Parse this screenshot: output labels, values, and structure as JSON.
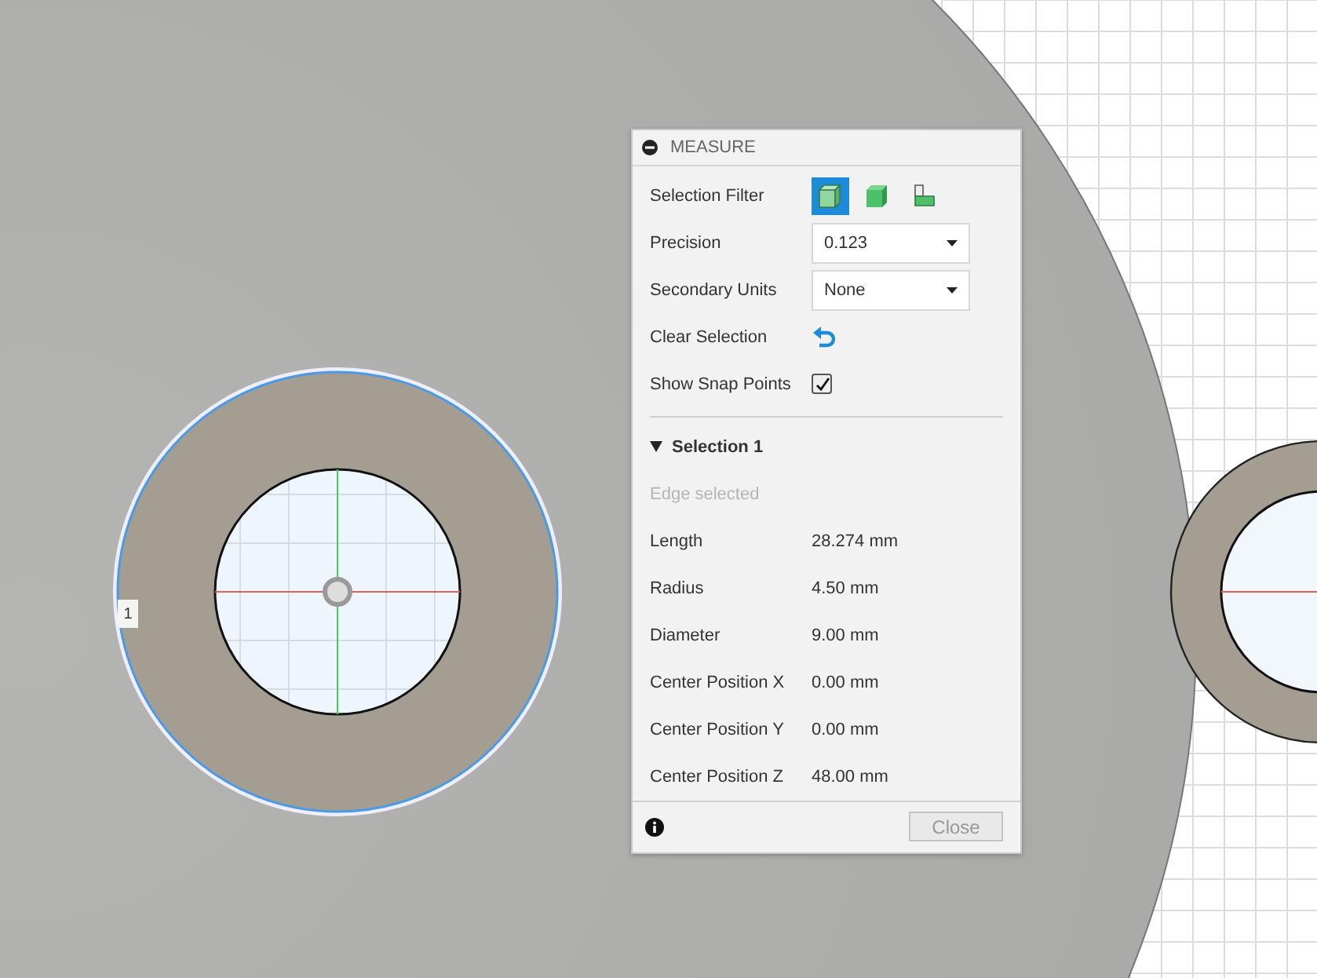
{
  "viewport": {
    "marker_label": "1"
  },
  "panel": {
    "title": "MEASURE",
    "selection_filter": {
      "label": "Selection Filter",
      "options": [
        {
          "kind": "face",
          "selected": true
        },
        {
          "kind": "body",
          "selected": false
        },
        {
          "kind": "edge",
          "selected": false
        }
      ]
    },
    "precision": {
      "label": "Precision",
      "value": "0.123"
    },
    "secondary_units": {
      "label": "Secondary Units",
      "value": "None"
    },
    "clear_selection": {
      "label": "Clear Selection"
    },
    "show_snap_points": {
      "label": "Show Snap Points",
      "checked": true
    },
    "section": {
      "title": "Selection 1",
      "expanded": true,
      "subtitle": "Edge selected",
      "rows": [
        {
          "label": "Length",
          "value": "28.274 mm"
        },
        {
          "label": "Radius",
          "value": "4.50 mm"
        },
        {
          "label": "Diameter",
          "value": "9.00 mm"
        },
        {
          "label": "Center Position X",
          "value": "0.00 mm"
        },
        {
          "label": "Center Position Y",
          "value": "0.00 mm"
        },
        {
          "label": "Center Position Z",
          "value": "48.00 mm"
        }
      ]
    },
    "close_button": "Close"
  }
}
